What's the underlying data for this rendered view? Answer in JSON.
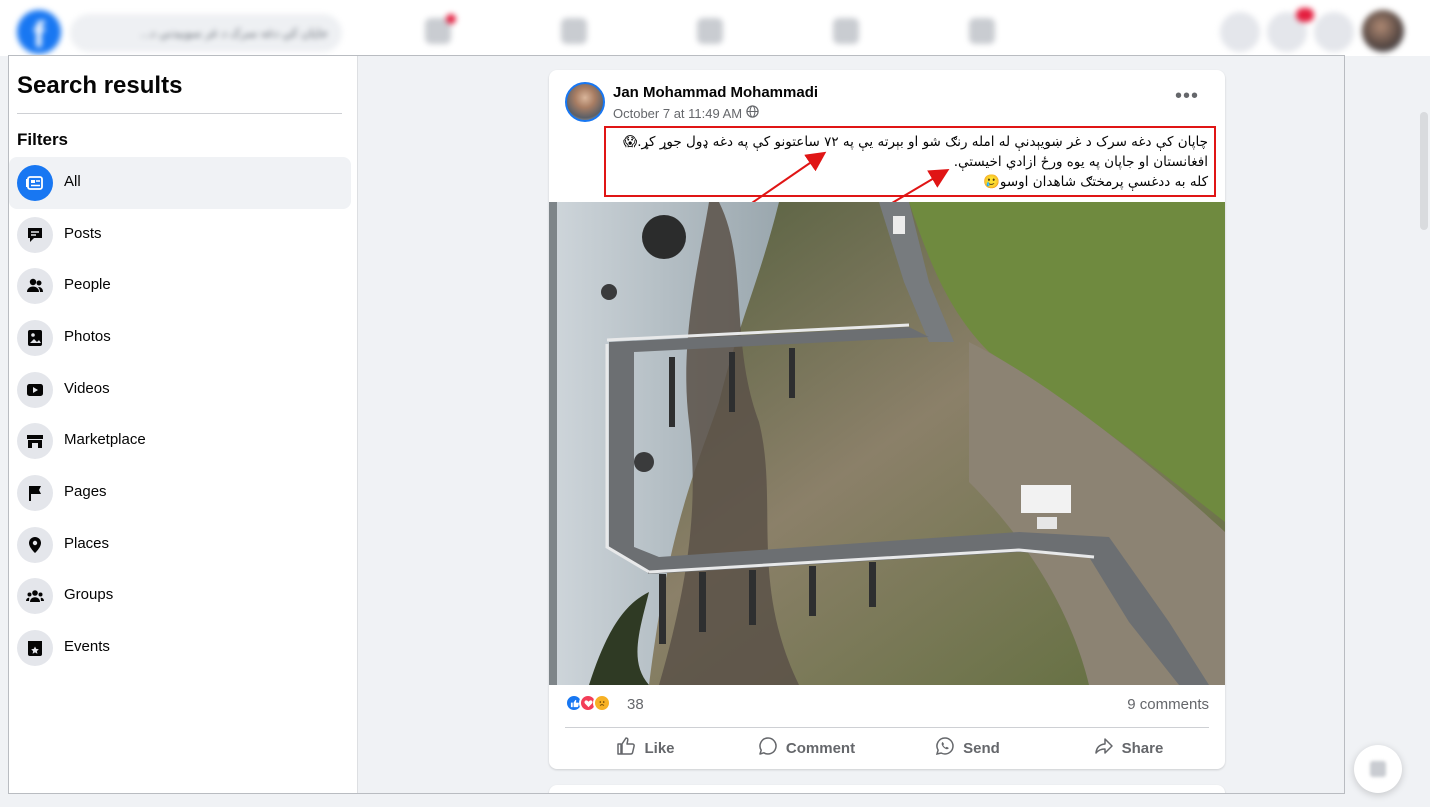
{
  "top_nav": {
    "search_placeholder": "جاپان کې دغه سرک د غر سوبیدنې د..."
  },
  "sidebar": {
    "title": "Search results",
    "filters_label": "Filters",
    "items": [
      {
        "label": "All",
        "icon": "feed-icon",
        "active": true
      },
      {
        "label": "Posts",
        "icon": "posts-icon",
        "active": false
      },
      {
        "label": "People",
        "icon": "people-icon",
        "active": false
      },
      {
        "label": "Photos",
        "icon": "photos-icon",
        "active": false
      },
      {
        "label": "Videos",
        "icon": "videos-icon",
        "active": false
      },
      {
        "label": "Marketplace",
        "icon": "marketplace-icon",
        "active": false
      },
      {
        "label": "Pages",
        "icon": "flag-icon",
        "active": false
      },
      {
        "label": "Places",
        "icon": "pin-icon",
        "active": false
      },
      {
        "label": "Groups",
        "icon": "groups-icon",
        "active": false
      },
      {
        "label": "Events",
        "icon": "events-icon",
        "active": false
      }
    ]
  },
  "post": {
    "author": "Jan Mohammad Mohammadi",
    "timestamp": "October 7 at 11:49 AM",
    "privacy_icon": "globe-icon",
    "text_lines": [
      "چاپان کې دغه سرک د غر ښویېدنې له امله رنګ شو او بېرته یې په ۷۲ ساعتونو کې په دغه ډول جوړ کړ.😱",
      "افغانستان او جاپان په یوه ورځ ازادي اخیستې.",
      "کله به ددغسې پرمختګ شاهدان اوسو🥲"
    ],
    "photo_description_hidden": "",
    "reaction_count": "38",
    "comments_count": "9 comments",
    "actions": {
      "like": "Like",
      "comment": "Comment",
      "send": "Send",
      "share": "Share"
    }
  },
  "colors": {
    "brand": "#1877f2",
    "highlight_box": "#e01515",
    "background": "#f0f2f5"
  }
}
